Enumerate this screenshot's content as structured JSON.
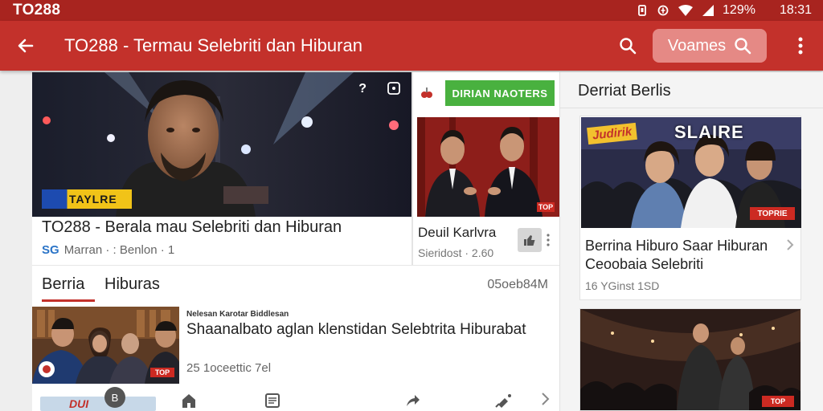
{
  "status_bar": {
    "left_text": "TO288",
    "battery_text": "129%",
    "time": "18:31"
  },
  "app_bar": {
    "title": "TO288 - Termau Selebriti dan Hiburan",
    "chip_label": "Voames"
  },
  "hero": {
    "badge_text": "TAYLRE",
    "top_icon_1": "?",
    "title": "TO288 - Berala mau Selebriti dan Hiburan",
    "source": "SG",
    "meta": "Marran · : Benlon · 1"
  },
  "side_card": {
    "tag_text": "DIRIAN NAOTERS",
    "title": "Deuil Karlvra",
    "meta": "Sieridost · 2.60",
    "thumb_tag": "TOP"
  },
  "section": {
    "tab_active": "Berria",
    "tab_other": "Hiburas",
    "count": "05oeb84M"
  },
  "list_item": {
    "source": "Nelesan Karotar Biddlesan",
    "title": "Shaanalbato aglan klenstidan Selebtrita Hiburabat",
    "meta": "25 1oceettic 7el",
    "thumb_tag": "TOP"
  },
  "bottom_nav": {
    "badge": "B",
    "thumb_text": "DUI"
  },
  "right_column": {
    "header": "Derriat Berlis",
    "card1": {
      "img_text_1": "Judirik",
      "img_text_2": "SLAIRE",
      "title": "Berrina Hiburo Saar Hiburan Ceoobaia Selebriti",
      "meta": "16 YGinst 1SD",
      "img_tag": "TOPRIE"
    },
    "card2": {
      "img_tag": "TOP"
    }
  },
  "colors": {
    "status_bar": "#a8241f",
    "app_bar": "#c3312b",
    "chip": "#e58985",
    "green_tag": "#49b13f",
    "accent_underline": "#c3312b"
  },
  "icons": [
    "back-arrow-icon",
    "search-icon",
    "more-vert-icon",
    "home-icon",
    "article-icon",
    "share-icon",
    "satellite-icon",
    "chevron-right-icon",
    "thumb-up-icon"
  ]
}
